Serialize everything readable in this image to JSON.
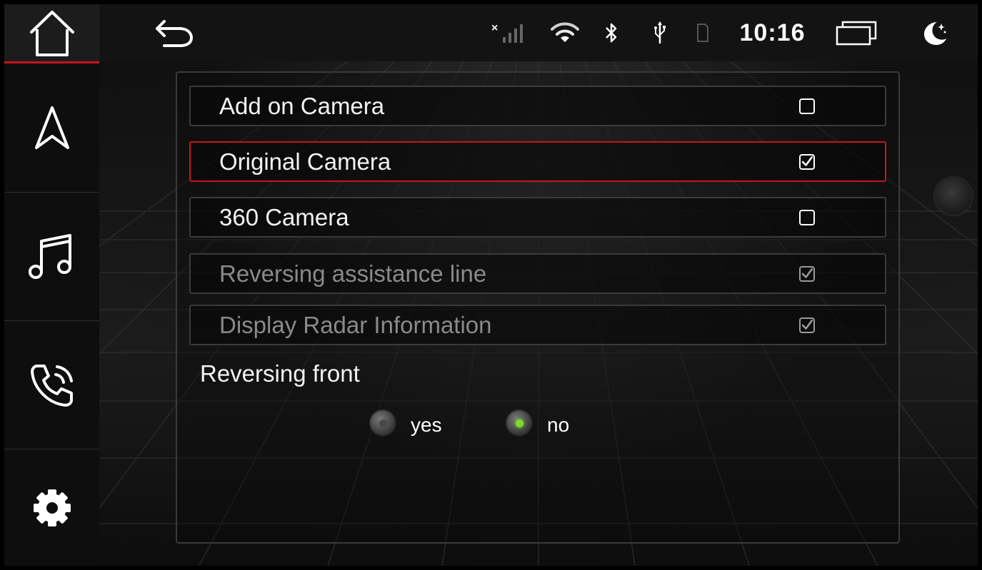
{
  "status_bar": {
    "back_icon": "back-arrow-icon",
    "icons": [
      "no-signal-icon",
      "wifi-icon",
      "bluetooth-icon",
      "usb-icon",
      "sim-card-icon"
    ],
    "time": "10:16",
    "recent_apps_icon": "recent-apps-icon",
    "night_mode_icon": "night-mode-icon"
  },
  "rail": {
    "items": [
      {
        "icon": "home-icon"
      },
      {
        "icon": "navigation-icon"
      },
      {
        "icon": "music-icon"
      },
      {
        "icon": "phone-icon"
      },
      {
        "icon": "settings-gear-icon"
      }
    ],
    "accent_color": "#c8141e"
  },
  "camera_settings": {
    "options": [
      {
        "label": "Add on Camera",
        "checked": false,
        "selected": false,
        "enabled": true
      },
      {
        "label": "Original Camera",
        "checked": true,
        "selected": true,
        "enabled": true
      },
      {
        "label": "360 Camera",
        "checked": false,
        "selected": false,
        "enabled": true
      },
      {
        "label": "Reversing assistance line",
        "checked": true,
        "selected": false,
        "enabled": false
      },
      {
        "label": "Display Radar Information",
        "checked": true,
        "selected": false,
        "enabled": false
      }
    ],
    "reversing_front": {
      "title": "Reversing front",
      "options": [
        {
          "label": "yes",
          "selected": false
        },
        {
          "label": "no",
          "selected": true
        }
      ],
      "selected_color": "#7ddc2a"
    }
  }
}
